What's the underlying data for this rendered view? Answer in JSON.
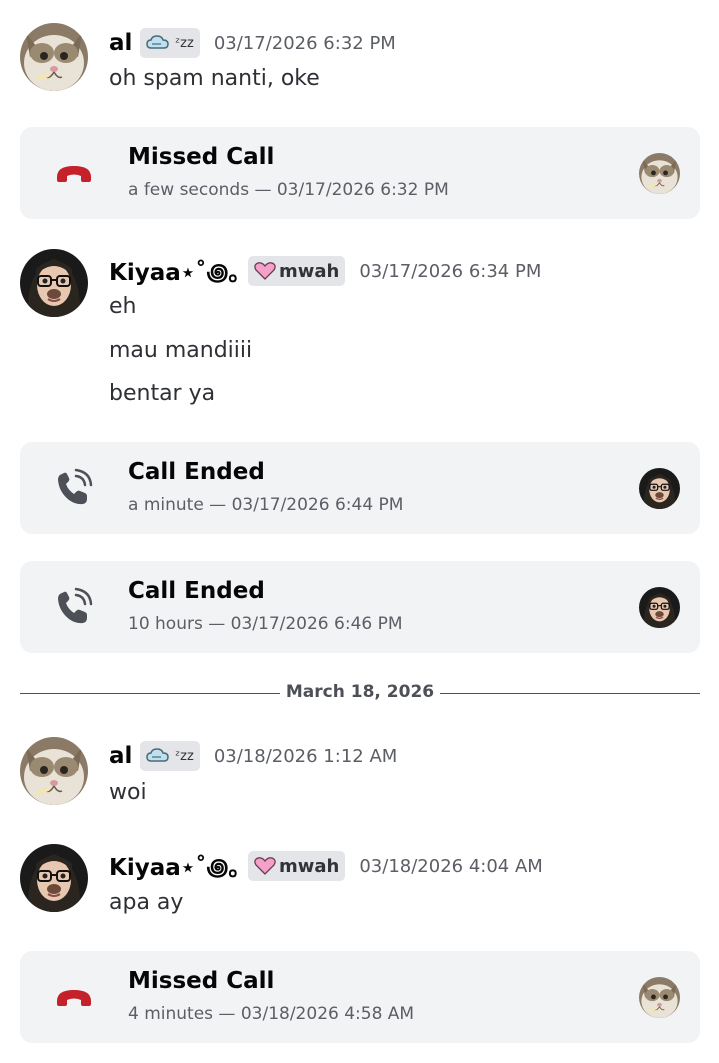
{
  "colors": {
    "missed_call_icon": "#c4212a",
    "call_ended_icon": "#4e5058",
    "card_background": "#f2f3f5",
    "tag_background": "#e3e5e8",
    "heart_pink": "#f5a0c8"
  },
  "messages": [
    {
      "avatar": "cat-avatar",
      "username": "al",
      "tag": {
        "icon": "cloud-sleep-icon",
        "text": "ᶻz𝗓"
      },
      "timestamp": "03/17/2026 6:32 PM",
      "lines": [
        "oh spam nanti, oke"
      ]
    },
    {
      "avatar": "girl-avatar",
      "username": "Kiyaa⋆˚꩜｡",
      "tag": {
        "icon": "pink-heart-icon",
        "text": "mwah"
      },
      "timestamp": "03/17/2026 6:34 PM",
      "lines": [
        "eh",
        "mau mandiiii",
        "bentar ya"
      ]
    },
    {
      "avatar": "cat-avatar",
      "username": "al",
      "tag": {
        "icon": "cloud-sleep-icon",
        "text": "ᶻz𝗓"
      },
      "timestamp": "03/18/2026 1:12 AM",
      "lines": [
        "woi"
      ]
    },
    {
      "avatar": "girl-avatar",
      "username": "Kiyaa⋆˚꩜｡",
      "tag": {
        "icon": "pink-heart-icon",
        "text": "mwah"
      },
      "timestamp": "03/18/2026 4:04 AM",
      "lines": [
        "apa ay"
      ]
    }
  ],
  "calls": [
    {
      "title": "Missed Call",
      "subtitle": "a few seconds — 03/17/2026 6:32 PM",
      "icon": "missed-call-icon",
      "avatar": "cat-avatar"
    },
    {
      "title": "Call Ended",
      "subtitle": "a minute — 03/17/2026 6:44 PM",
      "icon": "call-ended-icon",
      "avatar": "girl-avatar"
    },
    {
      "title": "Call Ended",
      "subtitle": "10 hours — 03/17/2026 6:46 PM",
      "icon": "call-ended-icon",
      "avatar": "girl-avatar"
    },
    {
      "title": "Missed Call",
      "subtitle": "4 minutes — 03/18/2026 4:58 AM",
      "icon": "missed-call-icon",
      "avatar": "cat-avatar"
    }
  ],
  "date_divider": "March 18, 2026"
}
